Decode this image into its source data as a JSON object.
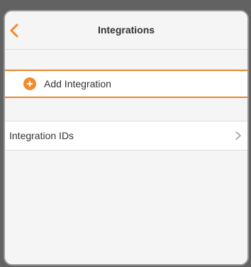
{
  "navbar": {
    "title": "Integrations",
    "back_icon": "chevron-left-icon"
  },
  "actions": {
    "add_label": "Add Integration",
    "add_icon": "plus-circle-icon"
  },
  "list": {
    "items": [
      {
        "label": "Integration IDs",
        "icon": "chevron-right-icon"
      }
    ]
  },
  "colors": {
    "accent": "#F08B2E",
    "background": "#F5F5F5",
    "row_background": "#FFFFFF",
    "outer_background": "#626262"
  }
}
